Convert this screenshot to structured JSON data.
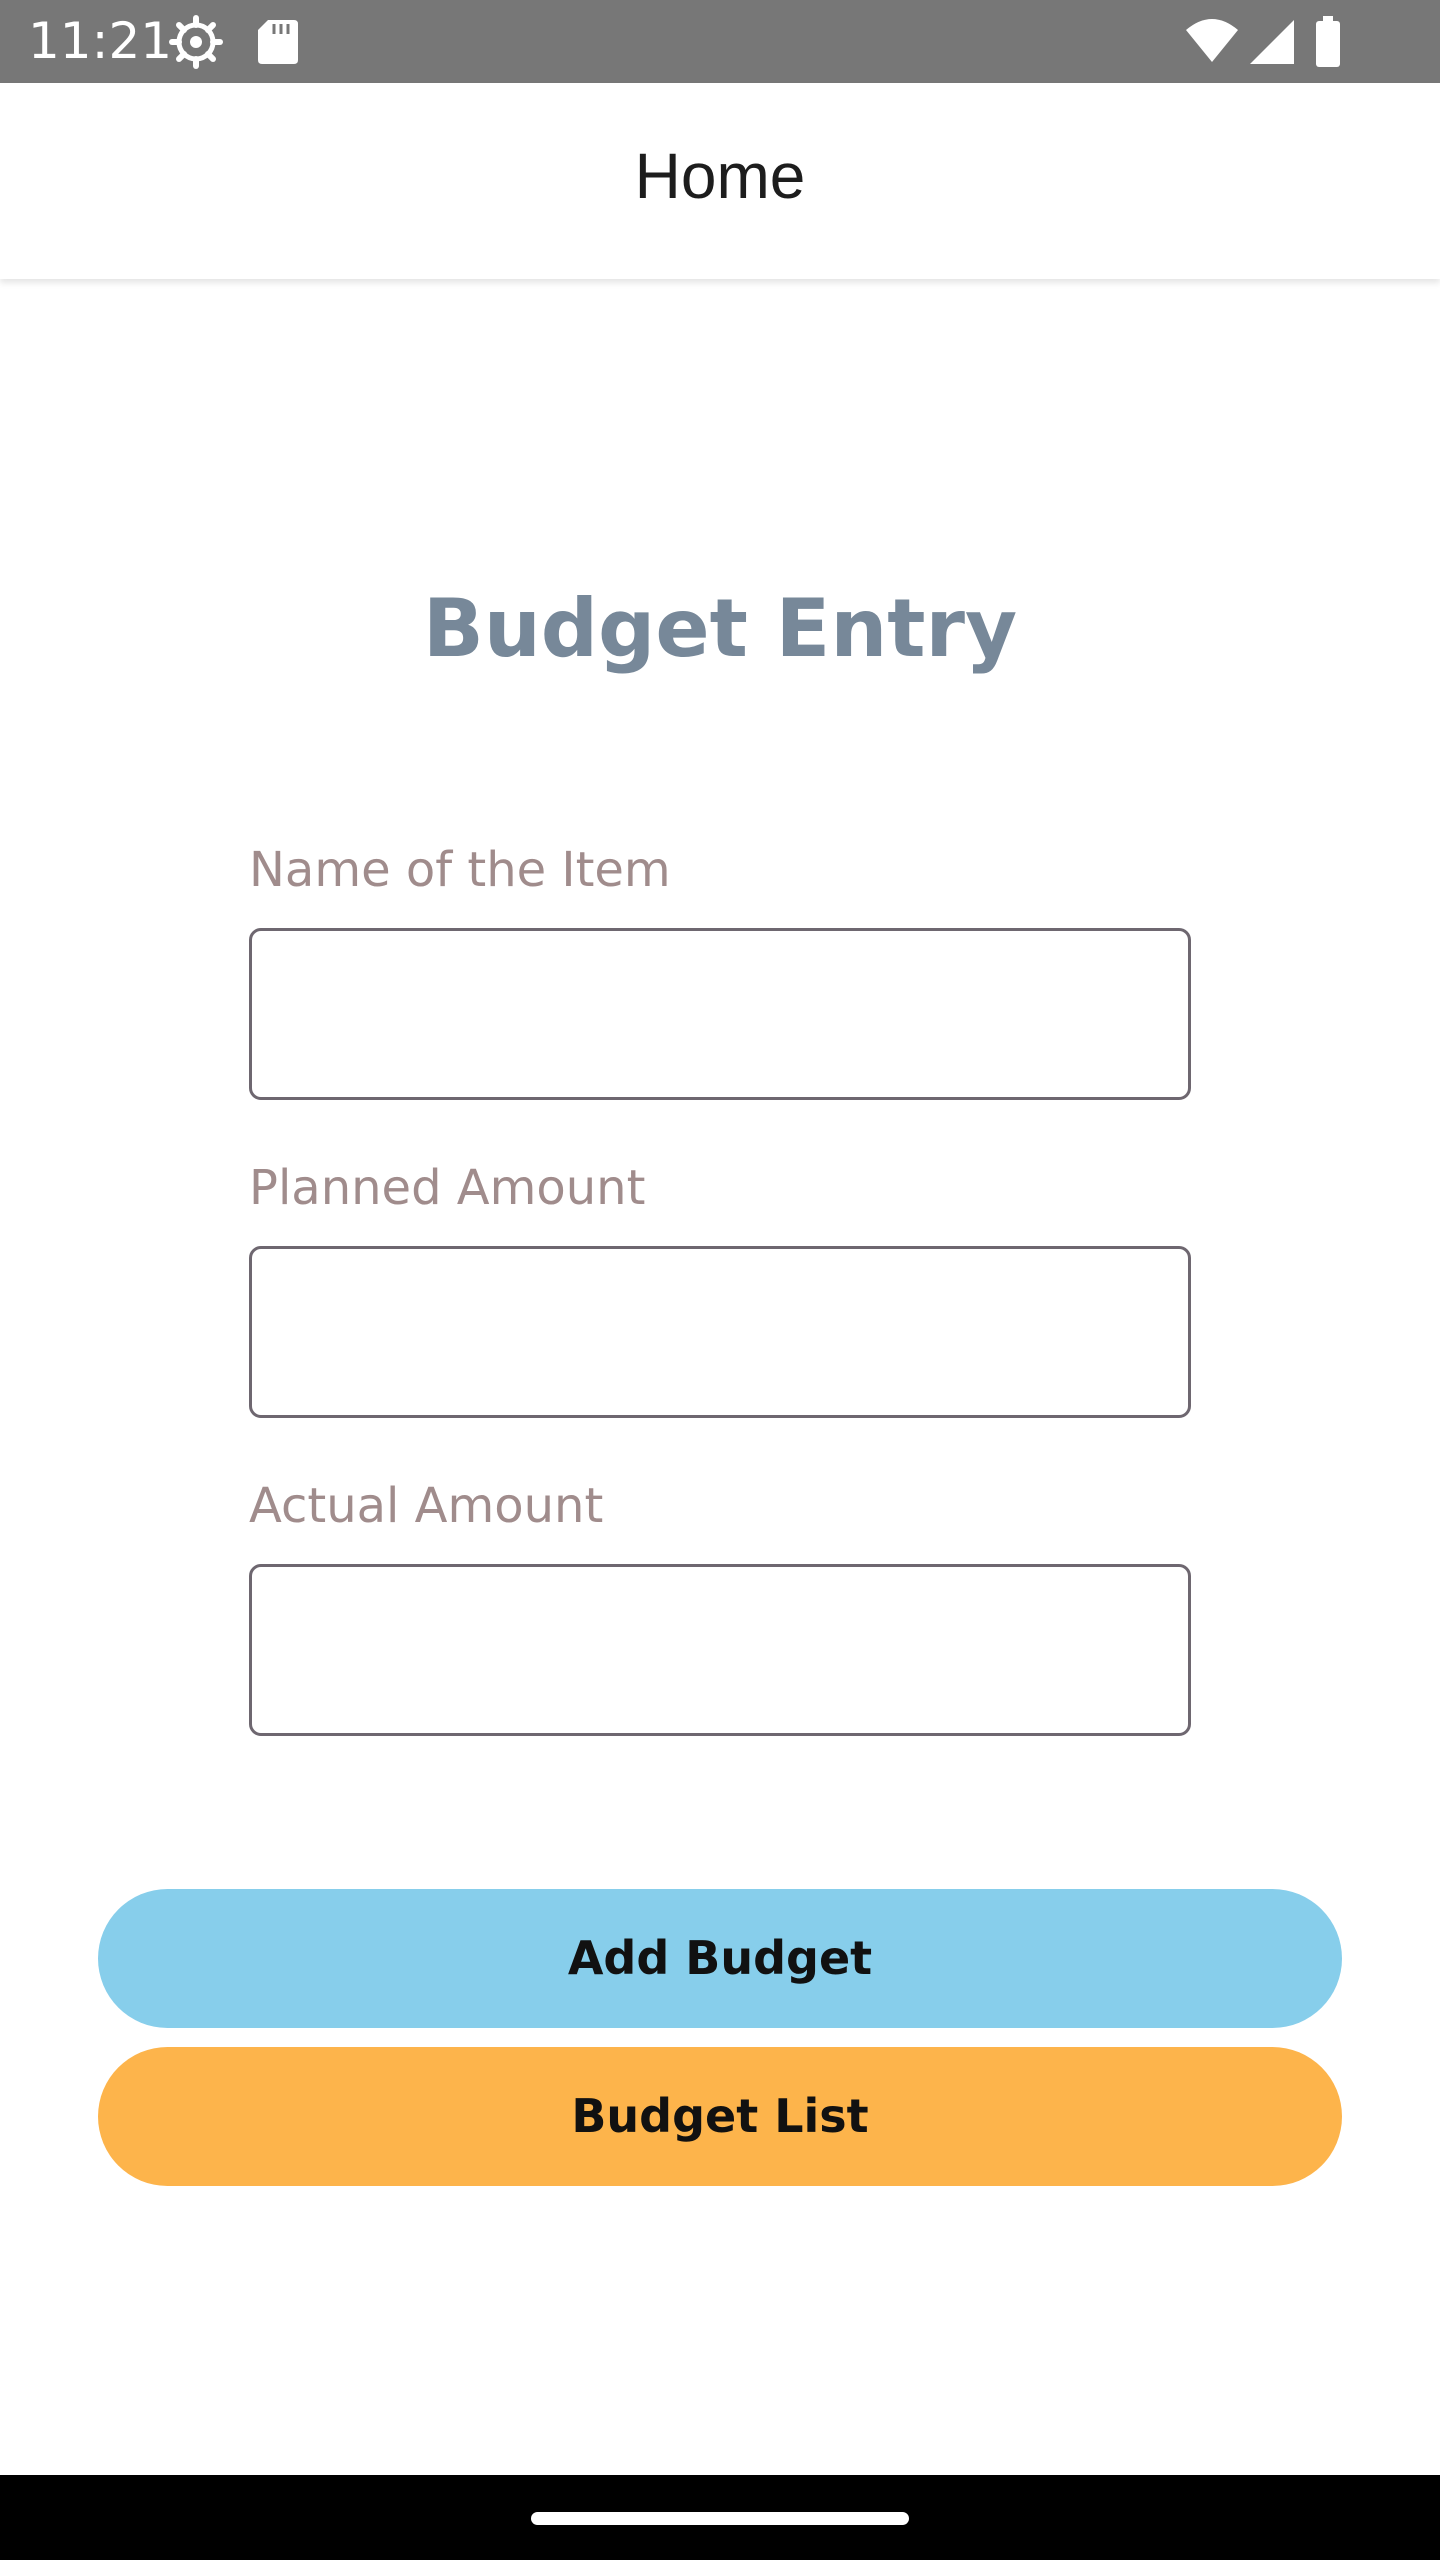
{
  "status_bar": {
    "time": "11:21",
    "icons": [
      "settings-gear-icon",
      "sd-card-icon",
      "wifi-icon",
      "signal-icon",
      "battery-icon"
    ]
  },
  "app_bar": {
    "title": "Home"
  },
  "form": {
    "title": "Budget Entry",
    "title_color": "#778899",
    "fields": [
      {
        "label": "Name of the Item",
        "value": ""
      },
      {
        "label": "Planned Amount",
        "value": ""
      },
      {
        "label": "Actual Amount",
        "value": ""
      }
    ]
  },
  "buttons": {
    "add_budget": {
      "label": "Add Budget",
      "color": "#87ceeb"
    },
    "budget_list": {
      "label": "Budget List",
      "color": "#fdb44b"
    }
  }
}
